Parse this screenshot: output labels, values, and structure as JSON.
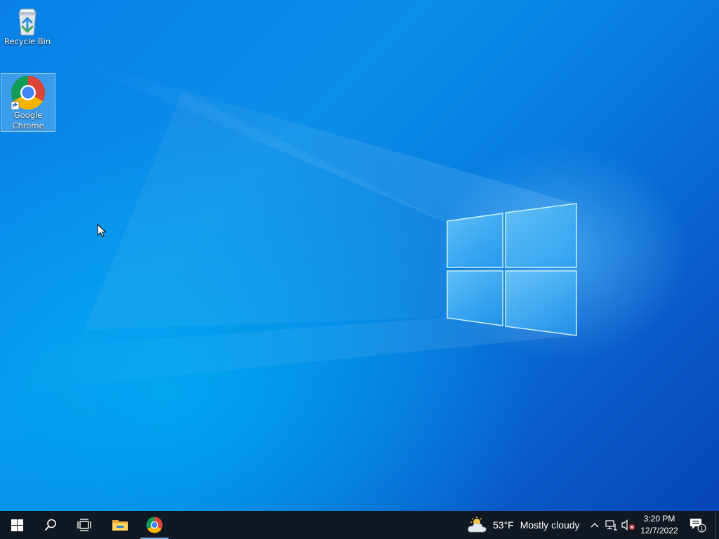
{
  "desktop": {
    "icons": [
      {
        "label": "Recycle Bin",
        "icon": "recycle-bin-icon"
      },
      {
        "label": "Google Chrome",
        "label_lines": [
          "Google",
          "Chrome"
        ],
        "icon": "chrome-icon",
        "selected": true
      }
    ],
    "wallpaper": {
      "accent": "#0a80e6",
      "logo": "windows-logo"
    }
  },
  "taskbar": {
    "background": "#101823",
    "buttons": [
      {
        "name": "start",
        "icon": "windows-logo-icon"
      },
      {
        "name": "search",
        "icon": "search-icon"
      },
      {
        "name": "task-view",
        "icon": "task-view-icon"
      },
      {
        "name": "file-explorer",
        "icon": "folder-icon"
      },
      {
        "name": "google-chrome",
        "icon": "chrome-icon",
        "running": true
      }
    ],
    "weather": {
      "icon": "partly-cloudy-icon",
      "temperature": "53°F",
      "condition": "Mostly cloudy"
    },
    "tray": {
      "icons": [
        "chevron-up-icon",
        "network-disconnected-icon",
        "volume-muted-icon"
      ]
    },
    "clock": {
      "time": "3:20 PM",
      "date": "12/7/2022"
    },
    "notifications": {
      "count": "1",
      "icon": "action-center-icon"
    }
  }
}
